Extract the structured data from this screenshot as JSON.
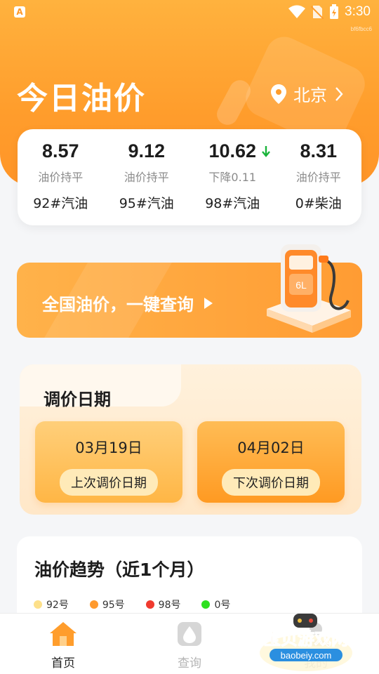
{
  "status": {
    "time": "3:30",
    "app_badge": "A",
    "device_id": "bf6fbcc6"
  },
  "header": {
    "title": "今日油价",
    "city": "北京"
  },
  "prices": [
    {
      "value": "8.57",
      "change": "油价持平",
      "name": "92#汽油",
      "trend": "flat"
    },
    {
      "value": "9.12",
      "change": "油价持平",
      "name": "95#汽油",
      "trend": "flat"
    },
    {
      "value": "10.62",
      "change": "下降0.11",
      "name": "98#汽油",
      "trend": "down"
    },
    {
      "value": "8.31",
      "change": "油价持平",
      "name": "0#柴油",
      "trend": "flat"
    }
  ],
  "banner": {
    "label": "全国油价，一键查询",
    "pump_label": "6L"
  },
  "adjust": {
    "title": "调价日期",
    "last": {
      "date": "03月19日",
      "label": "上次调价日期"
    },
    "next": {
      "date": "04月02日",
      "label": "下次调价日期"
    }
  },
  "trend": {
    "title": "油价趋势（近1个月）",
    "legend": [
      {
        "label": "92号",
        "color": "#fde08a"
      },
      {
        "label": "95号",
        "color": "#ff9a2e"
      },
      {
        "label": "98号",
        "color": "#f03a2e"
      },
      {
        "label": "0号",
        "color": "#2ee01f"
      }
    ]
  },
  "nav": [
    {
      "label": "首页",
      "active": true,
      "icon": "home-icon"
    },
    {
      "label": "查询",
      "active": false,
      "icon": "drop-icon"
    },
    {
      "label": "我的",
      "active": false,
      "icon": "user-icon"
    }
  ],
  "watermark": {
    "title": "宝贝游戏网",
    "url": "baobeiy.com"
  },
  "colors": {
    "accent": "#ff9d2c",
    "down": "#19b33a"
  }
}
